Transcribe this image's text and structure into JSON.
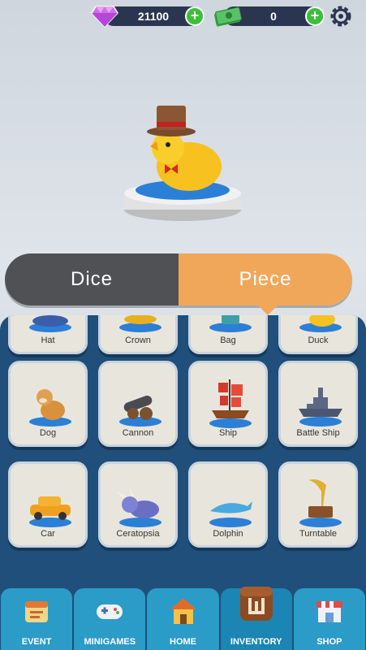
{
  "currency": {
    "gems": "21100",
    "cash": "0"
  },
  "toggle": {
    "dice_label": "Dice",
    "piece_label": "Piece",
    "active": "Piece"
  },
  "inventory": {
    "row1": [
      {
        "label": "Hat"
      },
      {
        "label": "Crown"
      },
      {
        "label": "Bag"
      },
      {
        "label": "Duck"
      }
    ],
    "row2": [
      {
        "label": "Dog"
      },
      {
        "label": "Cannon"
      },
      {
        "label": "Ship"
      },
      {
        "label": "Battle Ship"
      }
    ],
    "row3": [
      {
        "label": "Car"
      },
      {
        "label": "Ceratopsia"
      },
      {
        "label": "Dolphin"
      },
      {
        "label": "Turntable"
      }
    ]
  },
  "nav": [
    {
      "label": "EVENT"
    },
    {
      "label": "MINIGAMES"
    },
    {
      "label": "HOME"
    },
    {
      "label": "INVENTORY"
    },
    {
      "label": "SHOP"
    }
  ],
  "colors": {
    "accent_orange": "#f1a75a",
    "panel_blue": "#1f4f7a",
    "nav_blue": "#2b9bc8"
  }
}
